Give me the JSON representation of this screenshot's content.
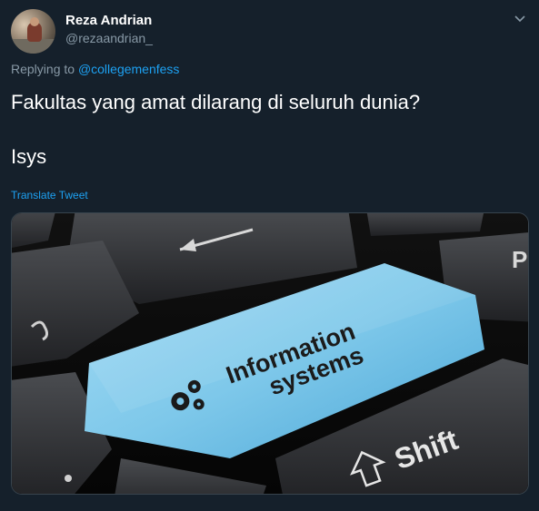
{
  "user": {
    "display_name": "Reza Andrian",
    "handle": "@rezaandrian_"
  },
  "reply": {
    "prefix": "Replying to ",
    "mention": "@collegemenfess"
  },
  "tweet": {
    "line1": "Fakultas yang amat dilarang di seluruh dunia?",
    "line2": "Isys"
  },
  "translate_label": "Translate Tweet",
  "media": {
    "key_text_line1": "Information",
    "key_text_line2": "systems",
    "shift_label": "Shift",
    "partial_key_label": "P"
  },
  "icons": {
    "menu": "chevron-down-icon",
    "gears": "gears-icon",
    "arrow": "left-arrow-icon",
    "shift": "shift-arrow-icon"
  },
  "colors": {
    "background": "#15202b",
    "link": "#1da1f2",
    "secondary_text": "#8899a6",
    "key_blue": "#7ec8ea"
  }
}
